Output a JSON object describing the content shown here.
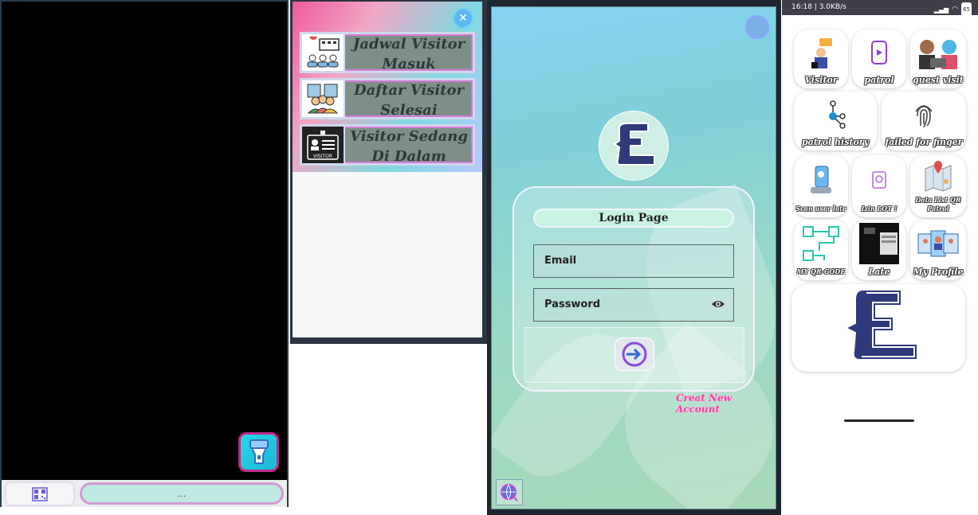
{
  "scanner": {
    "pill_text": "...",
    "qr_icon": "qr-code-icon",
    "flash_icon": "flashlight-icon"
  },
  "visitor_menu": {
    "close_icon": "close-icon",
    "items": [
      {
        "line1": "Jadwal Visitor",
        "line2": "Masuk",
        "icon": "schedule-visitor-icon"
      },
      {
        "line1": "Daftar Visitor",
        "line2": "Selesai",
        "icon": "visitor-list-icon"
      },
      {
        "line1": "Visitor Sedang",
        "line2": "Di Dalam",
        "icon": "visitor-id-card-icon"
      }
    ],
    "visitor_card_text": "VISITOR"
  },
  "login": {
    "title": "Login Page",
    "email_placeholder": "Email",
    "password_placeholder": "Password",
    "create_account": "Creat New Account",
    "submit_icon": "login-arrow-icon",
    "eye_icon": "eye-icon",
    "language_icon": "globe-icon"
  },
  "dashboard": {
    "status_bar": "16:18 | 3.0KB/s",
    "battery": "65",
    "tiles": [
      {
        "label": "Visitor",
        "icon": "visitor-icon"
      },
      {
        "label": "patrol",
        "icon": "phone-patrol-icon"
      },
      {
        "label": "guest visit",
        "icon": "guest-visit-icon"
      },
      {
        "label": "patrol history",
        "icon": "patrol-history-icon"
      },
      {
        "label": "failed for finger",
        "icon": "fingerprint-icon"
      },
      {
        "label": "Scan user late",
        "icon": "scan-user-icon"
      },
      {
        "label": "Izin LOT !",
        "icon": "permission-icon"
      },
      {
        "label": "Data List QR Patrol",
        "icon": "map-icon"
      },
      {
        "label": "MY QR-CODE",
        "icon": "qr-code-icon"
      },
      {
        "label": "Late",
        "icon": "late-photo-icon"
      },
      {
        "label": "My Profile",
        "icon": "profile-icon"
      }
    ],
    "logo_icon": "app-logo-icon"
  },
  "colors": {
    "accent_pink": "#ff3aa8",
    "accent_cyan": "#22d9e6",
    "brand_navy": "#2e3a7a"
  }
}
